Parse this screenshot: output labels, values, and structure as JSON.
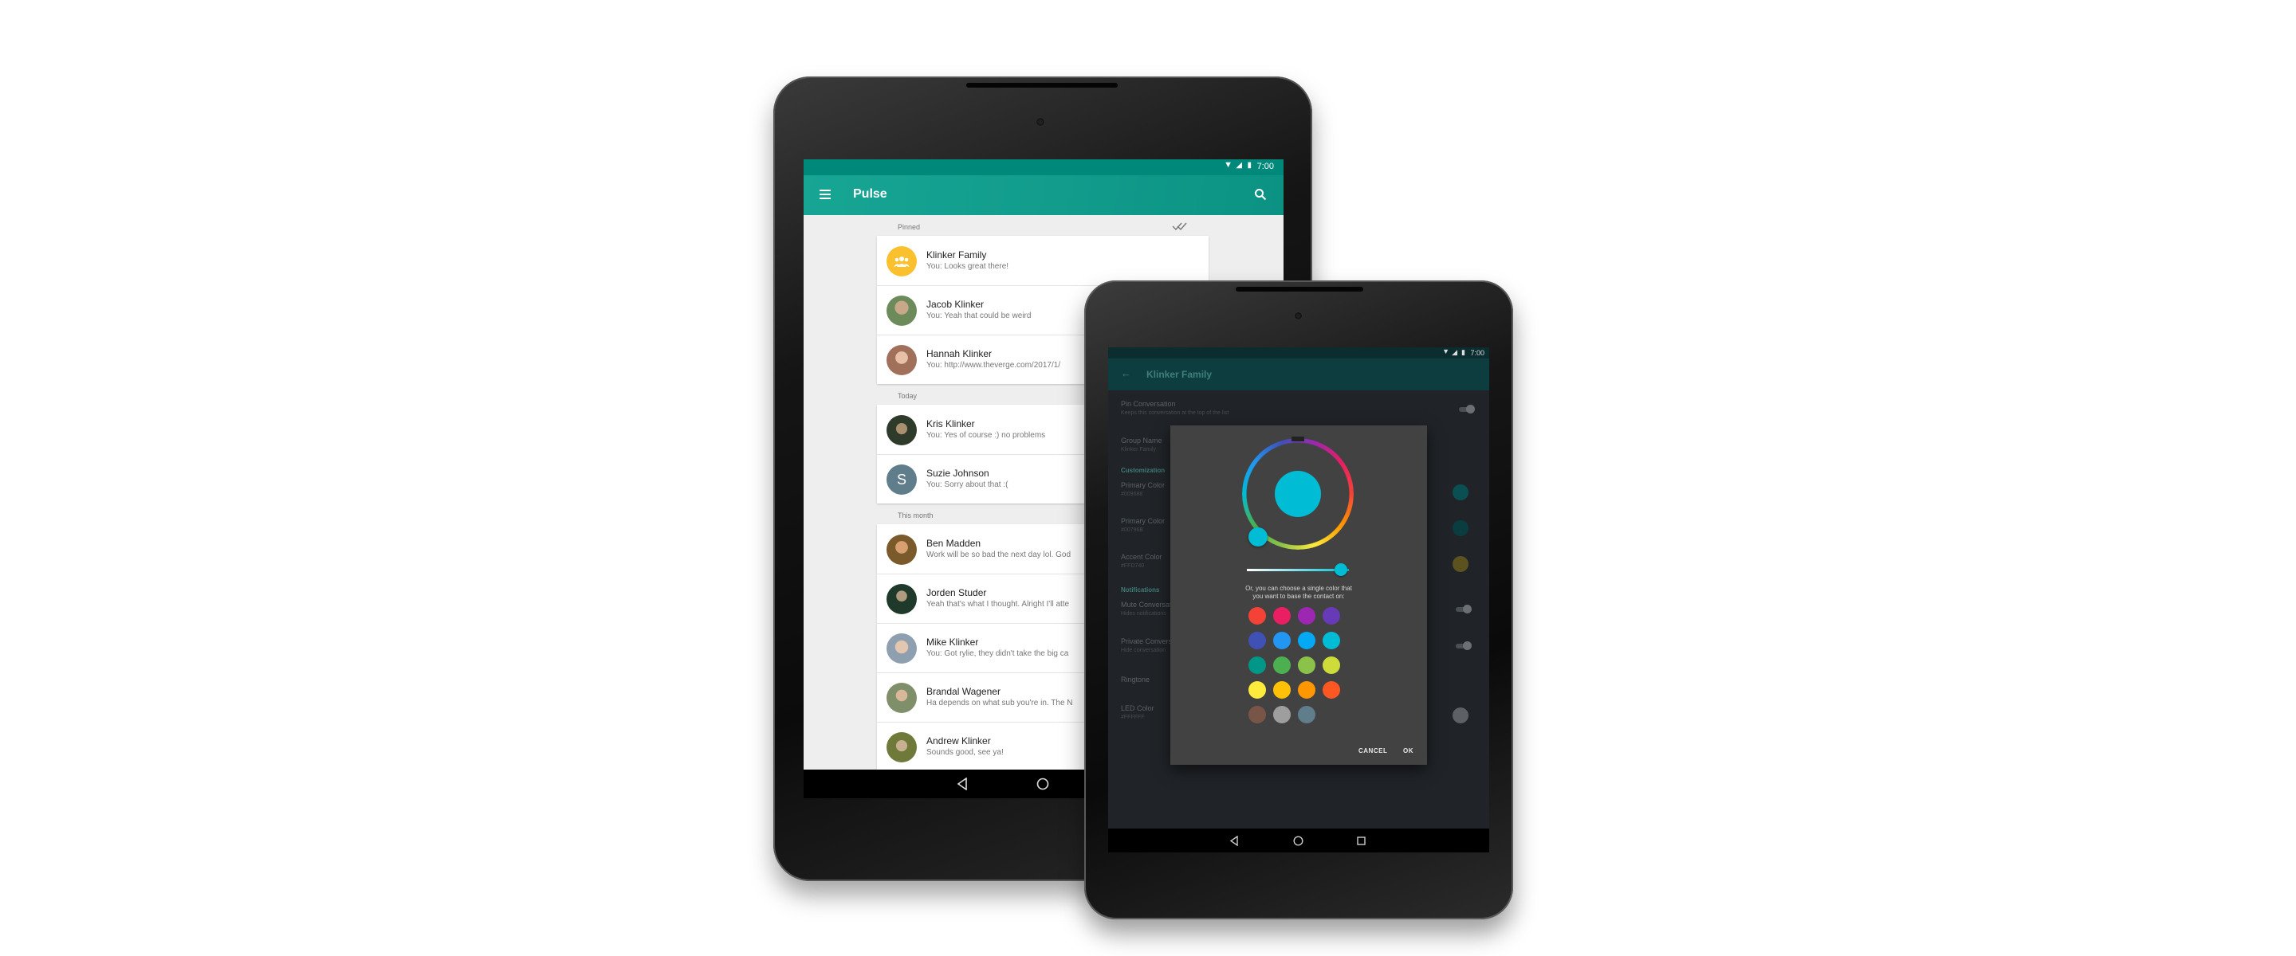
{
  "left_tablet": {
    "status": {
      "time": "7:00"
    },
    "toolbar": {
      "title": "Pulse"
    },
    "sections": {
      "pinned": "Pinned",
      "today": "Today",
      "month": "This month"
    },
    "conversations": [
      {
        "name": "Klinker Family",
        "snippet": "You: Looks great there!",
        "avatar_color": "#fbc02d"
      },
      {
        "name": "Jacob Klinker",
        "snippet": "You: Yeah that could be weird",
        "avatar_color": "#6d8b5a"
      },
      {
        "name": "Hannah Klinker",
        "snippet": "You: http://www.theverge.com/2017/1/",
        "avatar_color": "#a0705a"
      },
      {
        "name": "Kris Klinker",
        "snippet": "You: Yes of course :) no problems",
        "avatar_color": "#2e3b2a"
      },
      {
        "name": "Suzie Johnson",
        "snippet": "You: Sorry about that :(",
        "avatar_color": "#607d8b",
        "initial": "S"
      },
      {
        "name": "Ben Madden",
        "snippet": "Work will be so bad the next day lol. God",
        "avatar_color": "#7a5a2a"
      },
      {
        "name": "Jorden Studer",
        "snippet": "Yeah that's what I thought. Alright I'll atte",
        "avatar_color": "#1f3a2a"
      },
      {
        "name": "Mike Klinker",
        "snippet": "You: Got rylie, they didn't take the big ca",
        "avatar_color": "#8ea0b0"
      },
      {
        "name": "Brandal Wagener",
        "snippet": "Ha depends on what sub you're in. The N",
        "avatar_color": "#7f8f6a"
      },
      {
        "name": "Andrew Klinker",
        "snippet": "Sounds good, see ya!",
        "avatar_color": "#6f7a3a"
      }
    ]
  },
  "right_tablet": {
    "status": {
      "time": "7:00"
    },
    "toolbar": {
      "title": "Klinker Family"
    },
    "settings": {
      "pin_title": "Pin Conversation",
      "pin_sub": "Keeps this conversation at the top of the list",
      "group_title": "Group Name",
      "group_sub": "Klinker Family",
      "customization": "Customization",
      "primary_title": "Primary Color",
      "primary_sub": "#009688",
      "primary_dark_title": "Primary Color",
      "primary_dark_sub": "#00796B",
      "accent_title": "Accent Color",
      "accent_sub": "#FFD740",
      "notifications": "Notifications",
      "mute_title": "Mute Conversation",
      "mute_sub": "Hides notifications",
      "private_title": "Private Conversation",
      "private_sub": "Hide conversation",
      "ringtone_title": "Ringtone",
      "led_title": "LED Color",
      "led_sub": "#FFFFFF"
    },
    "dialog": {
      "selected_color": "#00bcd4",
      "text_line1": "Or, you can choose a single color that",
      "text_line2": "you want to base the contact on:",
      "swatches": [
        "#f44336",
        "#e91e63",
        "#9c27b0",
        "#673ab7",
        "#3f51b5",
        "#2196f3",
        "#03a9f4",
        "#00bcd4",
        "#009688",
        "#4caf50",
        "#8bc34a",
        "#cddc39",
        "#ffeb3b",
        "#ffc107",
        "#ff9800",
        "#ff5722",
        "#795548",
        "#9e9e9e",
        "#607d8b"
      ],
      "cancel": "CANCEL",
      "ok": "OK"
    }
  }
}
